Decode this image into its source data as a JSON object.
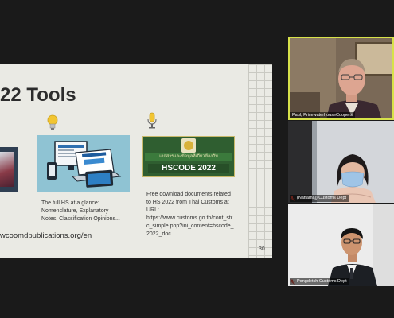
{
  "slide": {
    "title": "22 Tools",
    "col2_text_line1": "The full HS at a glance:",
    "col2_text_line2": "Nomenclature, Explanatory",
    "col2_text_line3": "Notes, Classification Opinions...",
    "col3_text_line1": "Free download documents related",
    "col3_text_line2": "to HS 2022 from Thai Customs at",
    "col3_text_line3": "URL:",
    "col3_url_line1": "https://www.customs.go.th/cont_str",
    "col3_url_line2": "c_simple.php?ini_content=hscode_",
    "col3_url_line3": "2022_doc",
    "banner_thai": "เอกสารและข้อมูลที่เกี่ยวข้องกับ",
    "banner_title": "HSCODE 2022",
    "url_left": "wcoomdpublications.org/en",
    "page_number": "30"
  },
  "participants": [
    {
      "name": "Paul, PricewaterhouseCoopers",
      "muted": false
    },
    {
      "name": "(Nattamaj) Customs Dept",
      "muted": true
    },
    {
      "name": "Pongdetch Customs Dept",
      "muted": true
    }
  ],
  "colors": {
    "background": "#1a1a1a",
    "active_speaker_border": "#d7e24a",
    "slide_bg": "#eaeae4"
  }
}
